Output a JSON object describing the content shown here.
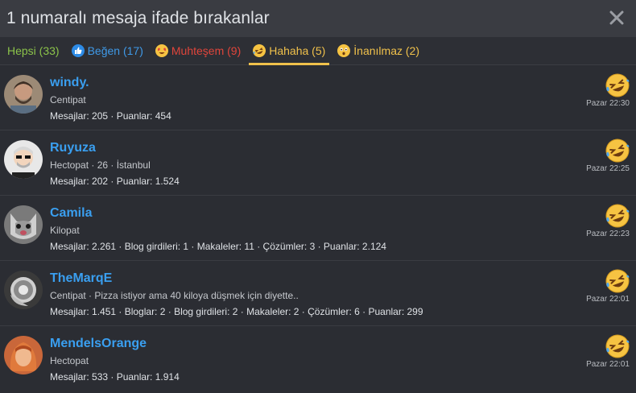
{
  "title": "1 numaralı mesaja ifade bırakanlar",
  "close_icon": "close-icon",
  "colors": {
    "accent": "#f0c14b",
    "link": "#3a9ff0",
    "all": "#8bc34a",
    "like": "#3f9ae8",
    "love": "#e0453b"
  },
  "tabs": [
    {
      "label": "Hepsi (33)",
      "icon": ""
    },
    {
      "label": "Beğen (17)",
      "icon": "like-icon"
    },
    {
      "label": "Muhteşem (9)",
      "icon": "heart-eyes-icon"
    },
    {
      "label": "Hahaha (5)",
      "icon": "laughing-icon",
      "active": true
    },
    {
      "label": "İnanılmaz (2)",
      "icon": "wow-icon"
    }
  ],
  "users": [
    {
      "name": "windy.",
      "title": "Centipat",
      "stats": "Mesajlar: 205 · Puanlar: 454",
      "time": "Pazar 22:30"
    },
    {
      "name": "Ruyuza",
      "title": "Hectopat · 26 · İstanbul",
      "stats": "Mesajlar: 202 · Puanlar: 1.524",
      "time": "Pazar 22:25"
    },
    {
      "name": "Camila",
      "title": "Kilopat",
      "stats": "Mesajlar: 2.261 · Blog girdileri: 1 · Makaleler: 11 · Çözümler: 3 · Puanlar: 2.124",
      "time": "Pazar 22:23"
    },
    {
      "name": "TheMarqE",
      "title": "Centipat · Pizza istiyor ama 40 kiloya düşmek için diyette..",
      "stats": "Mesajlar: 1.451 · Bloglar: 2 · Blog girdileri: 2 · Makaleler: 2 · Çözümler: 6 · Puanlar: 299",
      "time": "Pazar 22:01"
    },
    {
      "name": "MendelsOrange",
      "title": "Hectopat",
      "stats": "Mesajlar: 533 · Puanlar: 1.914",
      "time": "Pazar 22:01"
    }
  ]
}
